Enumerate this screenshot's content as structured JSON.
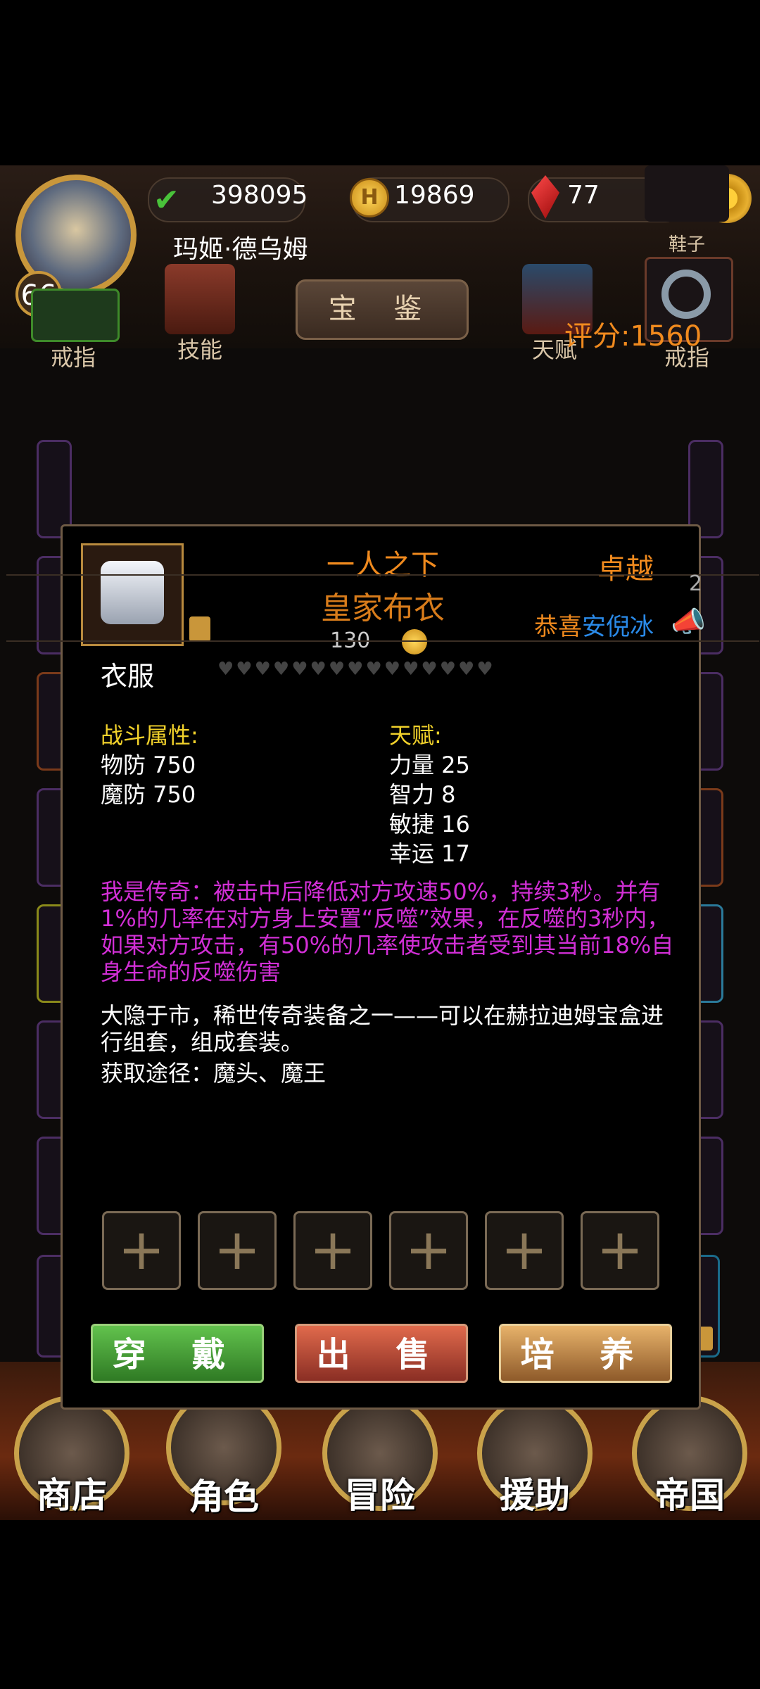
{
  "header": {
    "gems_value": "398095",
    "gold_value": "19869",
    "ruby_value": "77",
    "player_name": "玛姬·德乌姆",
    "level": "66",
    "treasure_button": "宝 鉴",
    "score": "评分:1560"
  },
  "menu": {
    "ring_left": "戒指",
    "skills": "技能",
    "talent": "天赋",
    "ring_right": "戒指",
    "shoes": "鞋子"
  },
  "popup": {
    "subtitle": "一人之下",
    "item_name": "皇家布衣",
    "quality": "卓越",
    "price": "130",
    "broadcast_prefix": "恭喜",
    "broadcast_name": "安倪冰",
    "category": "衣服",
    "hearts": "♥♥♥♥♥♥♥♥♥♥♥♥♥♥♥",
    "combat_header": "战斗属性:",
    "combat_stats": [
      "物防 750",
      "魔防 750"
    ],
    "talent_header": "天赋:",
    "talent_stats": [
      "力量 25",
      "智力 8",
      "敏捷 16",
      "幸运 17"
    ],
    "legend_text": "我是传奇：被击中后降低对方攻速50%，持续3秒。并有1%的几率在对方身上安置“反噬”效果，在反噬的3秒内，如果对方攻击，有50%的几率使攻击者受到其当前18%自身生命的反噬伤害",
    "flavor_text": "大隐于市，稀世传奇装备之一——可以在赫拉迪姆宝盒进行组套，组成套装。",
    "source_text": "获取途径：魔头、魔王",
    "socket_symbol": "+",
    "equip_label": "穿 戴",
    "sell_label": "出 售",
    "train_label": "培 养",
    "side_count": "2"
  },
  "nav": {
    "shop": "商店",
    "character": "角色",
    "adventure": "冒险",
    "support": "援助",
    "empire": "帝国"
  }
}
